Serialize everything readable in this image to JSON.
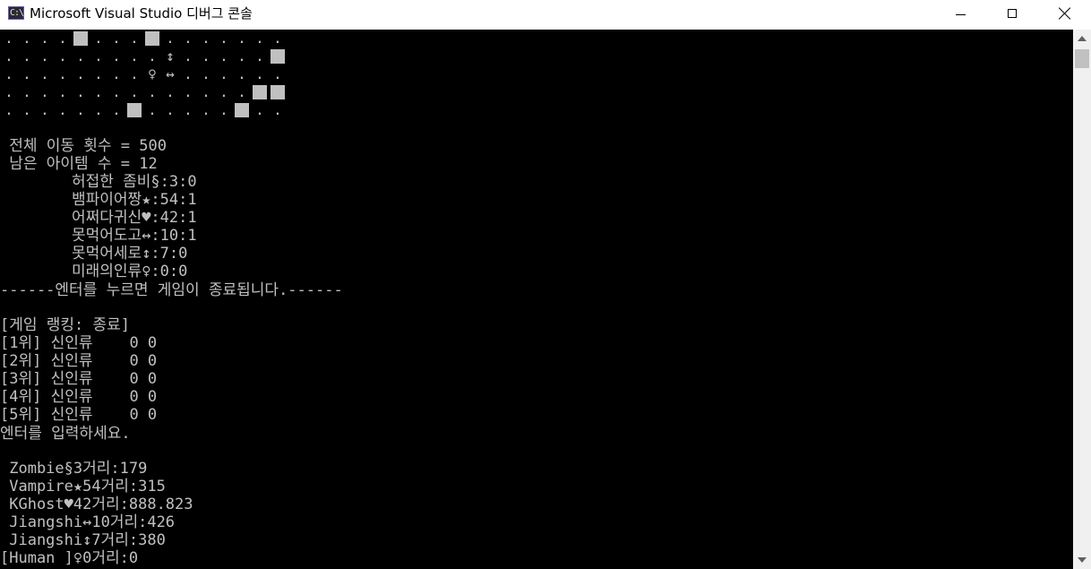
{
  "window": {
    "title": "Microsoft Visual Studio 디버그 콘솔",
    "icon_text": "C:\\",
    "icon": "console-app-icon"
  },
  "controls": {
    "minimize": "minimize-icon",
    "maximize": "maximize-icon",
    "close": "close-icon"
  },
  "colors": {
    "console_bg": "#000000",
    "console_text": "#c0c0c0",
    "titlebar_bg": "#ffffff",
    "scrollbar_bg": "#f0f0f0"
  },
  "grid": {
    "rows": [
      ". . . . ■ . . . ■ . . . . . . .",
      ". . . . . . . . . ↕ . . . . . ■",
      ". . . . . . . . ♀ ↔ . . . . . .",
      ". . . . . . . . . . . . . . ■ ■",
      ". . . . . . . ■ . . . . . ■ . ."
    ]
  },
  "stats": {
    "total_moves": " 전체 이동 횟수 = 500",
    "remaining_items": " 남은 아이템 수 = 12",
    "characters": [
      "허접한 좀비§:3:0",
      "뱀파이어짱★:54:1",
      "어쩌다귀신♥:42:1",
      "못먹어도고↔:10:1",
      "못먹어세로↕:7:0",
      "미래의인류♀:0:0"
    ],
    "end_message": "------엔터를 누르면 게임이 종료됩니다.------"
  },
  "ranking": {
    "header": "[게임 랭킹: 종료]",
    "entries": [
      "[1위] 신인류    0 0",
      "[2위] 신인류    0 0",
      "[3위] 신인류    0 0",
      "[4위] 신인류    0 0",
      "[5위] 신인류    0 0"
    ],
    "prompt": "엔터를 입력하세요."
  },
  "distances": [
    " Zombie§3거리:179",
    " Vampire★54거리:315",
    " KGhost♥42거리:888.823",
    " Jiangshi↔10거리:426",
    " Jiangshi↕7거리:380",
    "[Human ]♀0거리:0"
  ]
}
